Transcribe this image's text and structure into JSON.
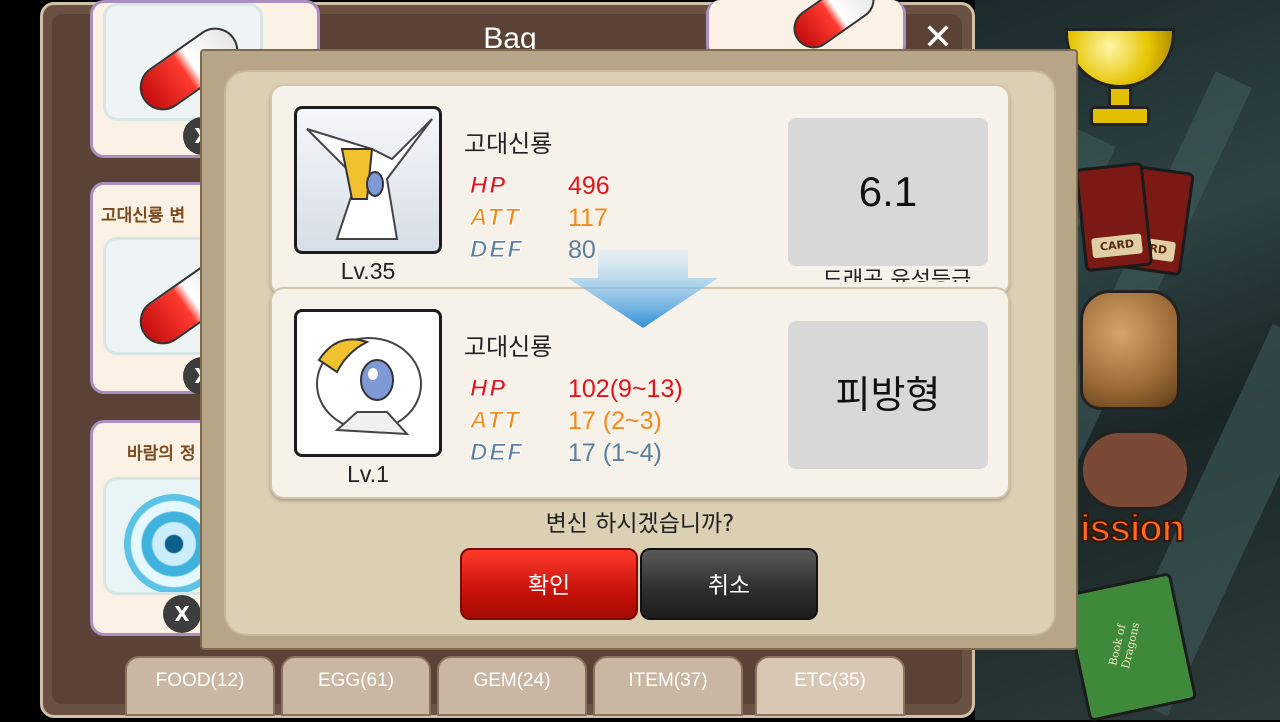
{
  "bag": {
    "title": "Bag",
    "close_label": "✕",
    "items": [
      {
        "name": ""
      },
      {
        "name": "고대신룡 변"
      },
      {
        "name": "바람의 정"
      }
    ],
    "badge_label": "X",
    "tabs": [
      {
        "label": "FOOD(12)"
      },
      {
        "label": "EGG(61)"
      },
      {
        "label": "GEM(24)"
      },
      {
        "label": "ITEM(37)"
      },
      {
        "label": "ETC(35)"
      }
    ]
  },
  "side": {
    "card_label": "CARD",
    "mission_label": "ission",
    "book_label": "Book of Dragons"
  },
  "dialog": {
    "before": {
      "name": "고대신룡",
      "level": "Lv.35",
      "hp_label": "HP",
      "att_label": "ATT",
      "def_label": "DEF",
      "hp": "496",
      "att": "117",
      "def": "80",
      "grade_value": "6.1",
      "grade_caption": "드래곤 육성등급"
    },
    "after": {
      "name": "고대신룡",
      "level": "Lv.1",
      "hp_label": "HP",
      "att_label": "ATT",
      "def_label": "DEF",
      "hp": "102(9~13)",
      "att": "17 (2~3)",
      "def": "17 (1~4)",
      "type": "피방형"
    },
    "question": "변신 하시겠습니까?",
    "confirm_label": "확인",
    "cancel_label": "취소"
  },
  "colors": {
    "hp": "#e3131b",
    "att": "#f28a1a",
    "def": "#5a7fa0",
    "confirm": "#e0180e",
    "cancel": "#2d2d2d"
  }
}
